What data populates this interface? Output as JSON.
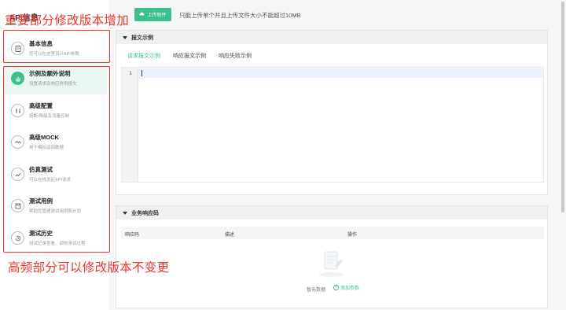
{
  "sidebar": {
    "header": "API信息",
    "items": [
      {
        "title": "基本信息",
        "subtitle": "您可以在这里设计API参数",
        "icon": "document-icon"
      },
      {
        "title": "示例及额外说明",
        "subtitle": "设置请求及响应样例报文",
        "icon": "hand-icon"
      },
      {
        "title": "高级配置",
        "subtitle": "熔断/降级及流量控制",
        "icon": "settings-icon"
      },
      {
        "title": "高级MOCK",
        "subtitle": "用于模拟返回数据",
        "icon": "mock-icon"
      },
      {
        "title": "仿真测试",
        "subtitle": "可以在线发起API请求",
        "icon": "test-icon"
      },
      {
        "title": "测试用例",
        "subtitle": "帮助您管理测试用例和计划",
        "icon": "save-icon"
      },
      {
        "title": "测试历史",
        "subtitle": "测试记录查看、调校测试过程",
        "icon": "history-icon"
      }
    ]
  },
  "toolbar": {
    "upload_label": "上传附件",
    "upload_hint": "只能上传单个并且上传文件大小不能超过10MB"
  },
  "message_panel": {
    "title": "报文示例",
    "tabs": [
      "请求报文示例",
      "响应报文示例",
      "响应失败示例"
    ],
    "active_tab": 0,
    "editor_line": "1"
  },
  "code_panel": {
    "title": "业务响应码",
    "columns": [
      "响应码",
      "描述",
      "操作"
    ],
    "empty_text": "暂无数据",
    "add_label": "添加参数"
  },
  "annotations": {
    "top": "重要部分修改版本增加",
    "bottom": "高频部分可以修改版本不变更"
  },
  "colors": {
    "accent": "#3cbf8c",
    "annotation": "#e8372d"
  }
}
